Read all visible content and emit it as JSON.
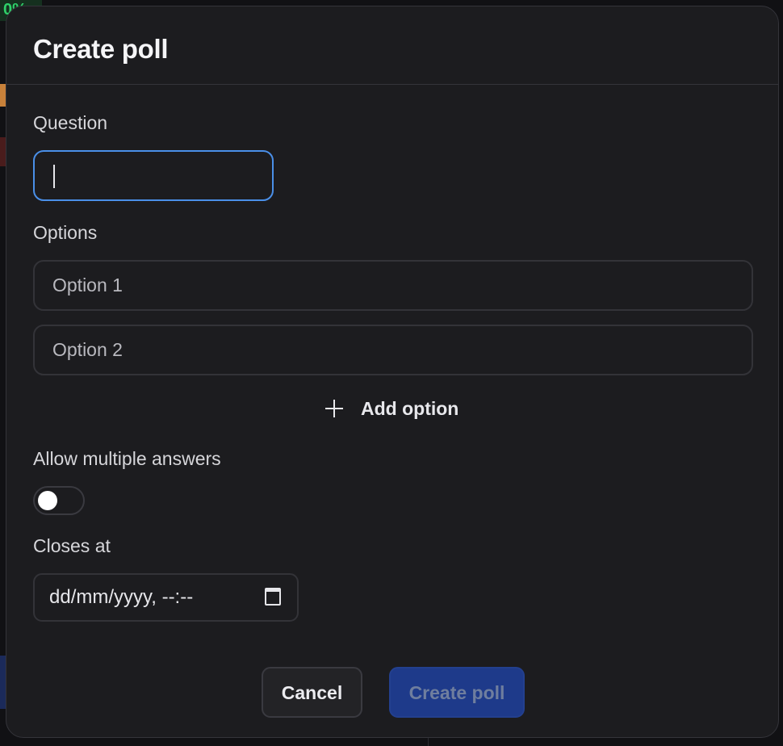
{
  "background": {
    "percent_badge": "0%"
  },
  "dialog": {
    "title": "Create poll",
    "question": {
      "label": "Question",
      "value": ""
    },
    "options": {
      "label": "Options",
      "items": [
        {
          "placeholder": "Option 1"
        },
        {
          "placeholder": "Option 2"
        }
      ],
      "add_label": "Add option"
    },
    "multiple_answers": {
      "label": "Allow multiple answers",
      "enabled": false
    },
    "closes_at": {
      "label": "Closes at",
      "placeholder": "dd/mm/yyyy, --:--"
    },
    "buttons": {
      "cancel": "Cancel",
      "submit": "Create poll"
    }
  },
  "colors": {
    "modal_bg": "#1c1c1f",
    "focus_border": "#4a8fe8",
    "primary_disabled": "#1e3a8a"
  }
}
